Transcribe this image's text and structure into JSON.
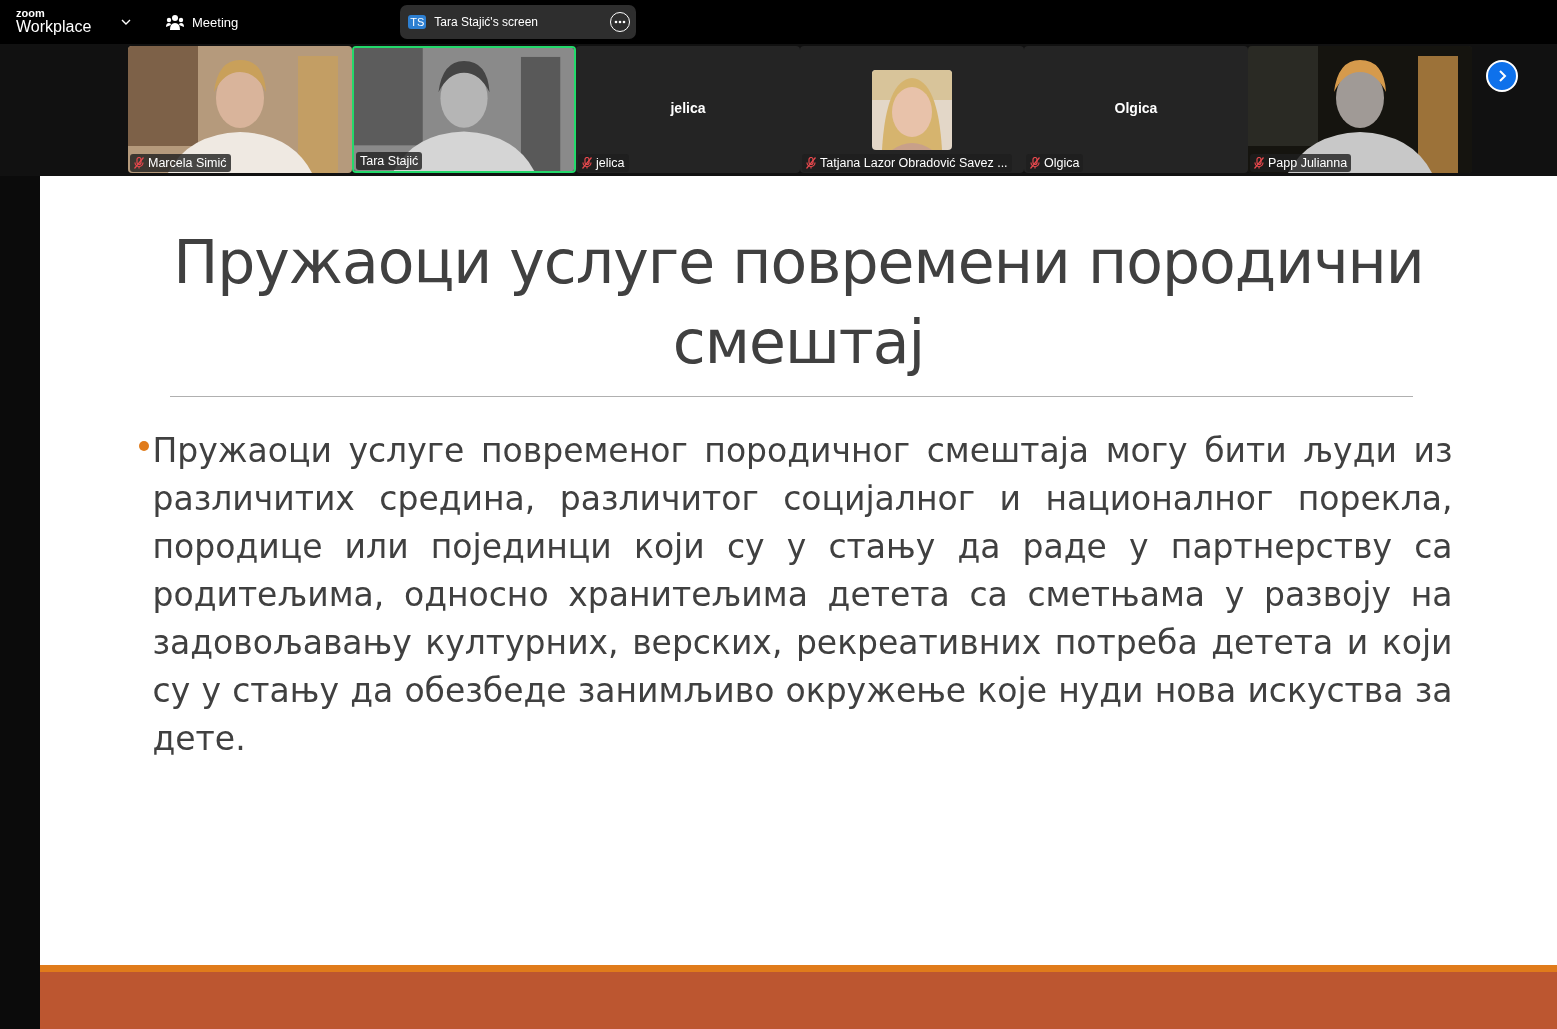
{
  "top_bar": {
    "logo_small": "zoom",
    "logo_large": "Workplace",
    "meeting_label": "Meeting",
    "share_pill": {
      "initials": "TS",
      "label": "Tara Stajić's screen"
    }
  },
  "participants": [
    {
      "kind": "video",
      "label": "Marcela Simić",
      "muted": true,
      "speaking": false
    },
    {
      "kind": "video",
      "label": "Tara Stajić",
      "muted": false,
      "speaking": true
    },
    {
      "kind": "name",
      "display_name": "jelica",
      "label": "jelica",
      "muted": true,
      "speaking": false
    },
    {
      "kind": "avatar",
      "label": "Tatjana Lazor Obradović Savez ...",
      "muted": true,
      "speaking": false
    },
    {
      "kind": "name",
      "display_name": "Olgica",
      "label": "Olgica",
      "muted": true,
      "speaking": false
    },
    {
      "kind": "video",
      "label": "Papp Julianna",
      "muted": true,
      "speaking": false
    }
  ],
  "slide": {
    "title": "Пружаоци услуге повремени породични смештај",
    "bullets": [
      "Пружаоци услуге повременог породичног смештаја могу бити људи из различитих средина, различитог социјалног и националног порекла, породице или појединци који су у стању да раде у партнерству са родитељима, односно хранитељима детета са сметњама у развоју на задовољавању културних, верских, рекреативних потреба детета и који су у стању да обезбеде занимљиво окружење које нуди нова искуства за дете."
    ]
  }
}
